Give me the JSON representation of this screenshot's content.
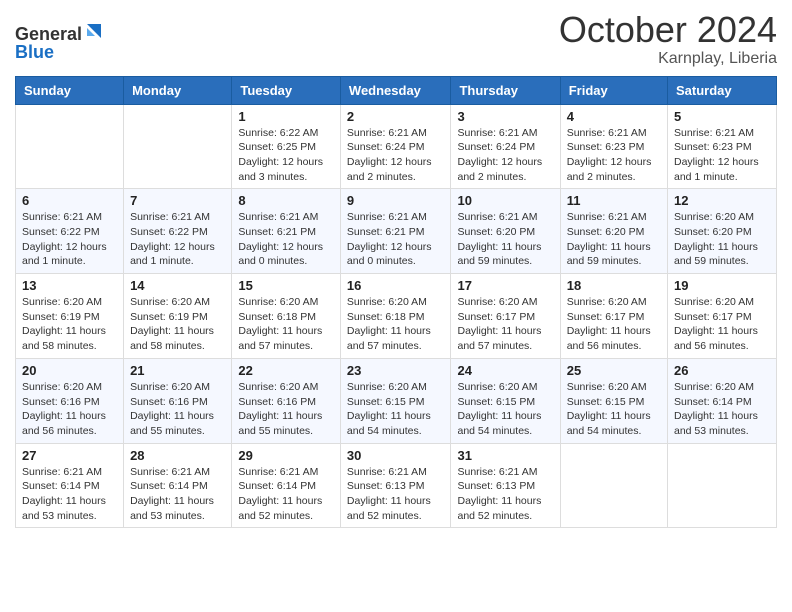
{
  "header": {
    "logo_line1": "General",
    "logo_line2": "Blue",
    "month_title": "October 2024",
    "location": "Karnplay, Liberia"
  },
  "days_of_week": [
    "Sunday",
    "Monday",
    "Tuesday",
    "Wednesday",
    "Thursday",
    "Friday",
    "Saturday"
  ],
  "weeks": [
    [
      {
        "day": "",
        "info": ""
      },
      {
        "day": "",
        "info": ""
      },
      {
        "day": "1",
        "info": "Sunrise: 6:22 AM\nSunset: 6:25 PM\nDaylight: 12 hours and 3 minutes."
      },
      {
        "day": "2",
        "info": "Sunrise: 6:21 AM\nSunset: 6:24 PM\nDaylight: 12 hours and 2 minutes."
      },
      {
        "day": "3",
        "info": "Sunrise: 6:21 AM\nSunset: 6:24 PM\nDaylight: 12 hours and 2 minutes."
      },
      {
        "day": "4",
        "info": "Sunrise: 6:21 AM\nSunset: 6:23 PM\nDaylight: 12 hours and 2 minutes."
      },
      {
        "day": "5",
        "info": "Sunrise: 6:21 AM\nSunset: 6:23 PM\nDaylight: 12 hours and 1 minute."
      }
    ],
    [
      {
        "day": "6",
        "info": "Sunrise: 6:21 AM\nSunset: 6:22 PM\nDaylight: 12 hours and 1 minute."
      },
      {
        "day": "7",
        "info": "Sunrise: 6:21 AM\nSunset: 6:22 PM\nDaylight: 12 hours and 1 minute."
      },
      {
        "day": "8",
        "info": "Sunrise: 6:21 AM\nSunset: 6:21 PM\nDaylight: 12 hours and 0 minutes."
      },
      {
        "day": "9",
        "info": "Sunrise: 6:21 AM\nSunset: 6:21 PM\nDaylight: 12 hours and 0 minutes."
      },
      {
        "day": "10",
        "info": "Sunrise: 6:21 AM\nSunset: 6:20 PM\nDaylight: 11 hours and 59 minutes."
      },
      {
        "day": "11",
        "info": "Sunrise: 6:21 AM\nSunset: 6:20 PM\nDaylight: 11 hours and 59 minutes."
      },
      {
        "day": "12",
        "info": "Sunrise: 6:20 AM\nSunset: 6:20 PM\nDaylight: 11 hours and 59 minutes."
      }
    ],
    [
      {
        "day": "13",
        "info": "Sunrise: 6:20 AM\nSunset: 6:19 PM\nDaylight: 11 hours and 58 minutes."
      },
      {
        "day": "14",
        "info": "Sunrise: 6:20 AM\nSunset: 6:19 PM\nDaylight: 11 hours and 58 minutes."
      },
      {
        "day": "15",
        "info": "Sunrise: 6:20 AM\nSunset: 6:18 PM\nDaylight: 11 hours and 57 minutes."
      },
      {
        "day": "16",
        "info": "Sunrise: 6:20 AM\nSunset: 6:18 PM\nDaylight: 11 hours and 57 minutes."
      },
      {
        "day": "17",
        "info": "Sunrise: 6:20 AM\nSunset: 6:17 PM\nDaylight: 11 hours and 57 minutes."
      },
      {
        "day": "18",
        "info": "Sunrise: 6:20 AM\nSunset: 6:17 PM\nDaylight: 11 hours and 56 minutes."
      },
      {
        "day": "19",
        "info": "Sunrise: 6:20 AM\nSunset: 6:17 PM\nDaylight: 11 hours and 56 minutes."
      }
    ],
    [
      {
        "day": "20",
        "info": "Sunrise: 6:20 AM\nSunset: 6:16 PM\nDaylight: 11 hours and 56 minutes."
      },
      {
        "day": "21",
        "info": "Sunrise: 6:20 AM\nSunset: 6:16 PM\nDaylight: 11 hours and 55 minutes."
      },
      {
        "day": "22",
        "info": "Sunrise: 6:20 AM\nSunset: 6:16 PM\nDaylight: 11 hours and 55 minutes."
      },
      {
        "day": "23",
        "info": "Sunrise: 6:20 AM\nSunset: 6:15 PM\nDaylight: 11 hours and 54 minutes."
      },
      {
        "day": "24",
        "info": "Sunrise: 6:20 AM\nSunset: 6:15 PM\nDaylight: 11 hours and 54 minutes."
      },
      {
        "day": "25",
        "info": "Sunrise: 6:20 AM\nSunset: 6:15 PM\nDaylight: 11 hours and 54 minutes."
      },
      {
        "day": "26",
        "info": "Sunrise: 6:20 AM\nSunset: 6:14 PM\nDaylight: 11 hours and 53 minutes."
      }
    ],
    [
      {
        "day": "27",
        "info": "Sunrise: 6:21 AM\nSunset: 6:14 PM\nDaylight: 11 hours and 53 minutes."
      },
      {
        "day": "28",
        "info": "Sunrise: 6:21 AM\nSunset: 6:14 PM\nDaylight: 11 hours and 53 minutes."
      },
      {
        "day": "29",
        "info": "Sunrise: 6:21 AM\nSunset: 6:14 PM\nDaylight: 11 hours and 52 minutes."
      },
      {
        "day": "30",
        "info": "Sunrise: 6:21 AM\nSunset: 6:13 PM\nDaylight: 11 hours and 52 minutes."
      },
      {
        "day": "31",
        "info": "Sunrise: 6:21 AM\nSunset: 6:13 PM\nDaylight: 11 hours and 52 minutes."
      },
      {
        "day": "",
        "info": ""
      },
      {
        "day": "",
        "info": ""
      }
    ]
  ]
}
